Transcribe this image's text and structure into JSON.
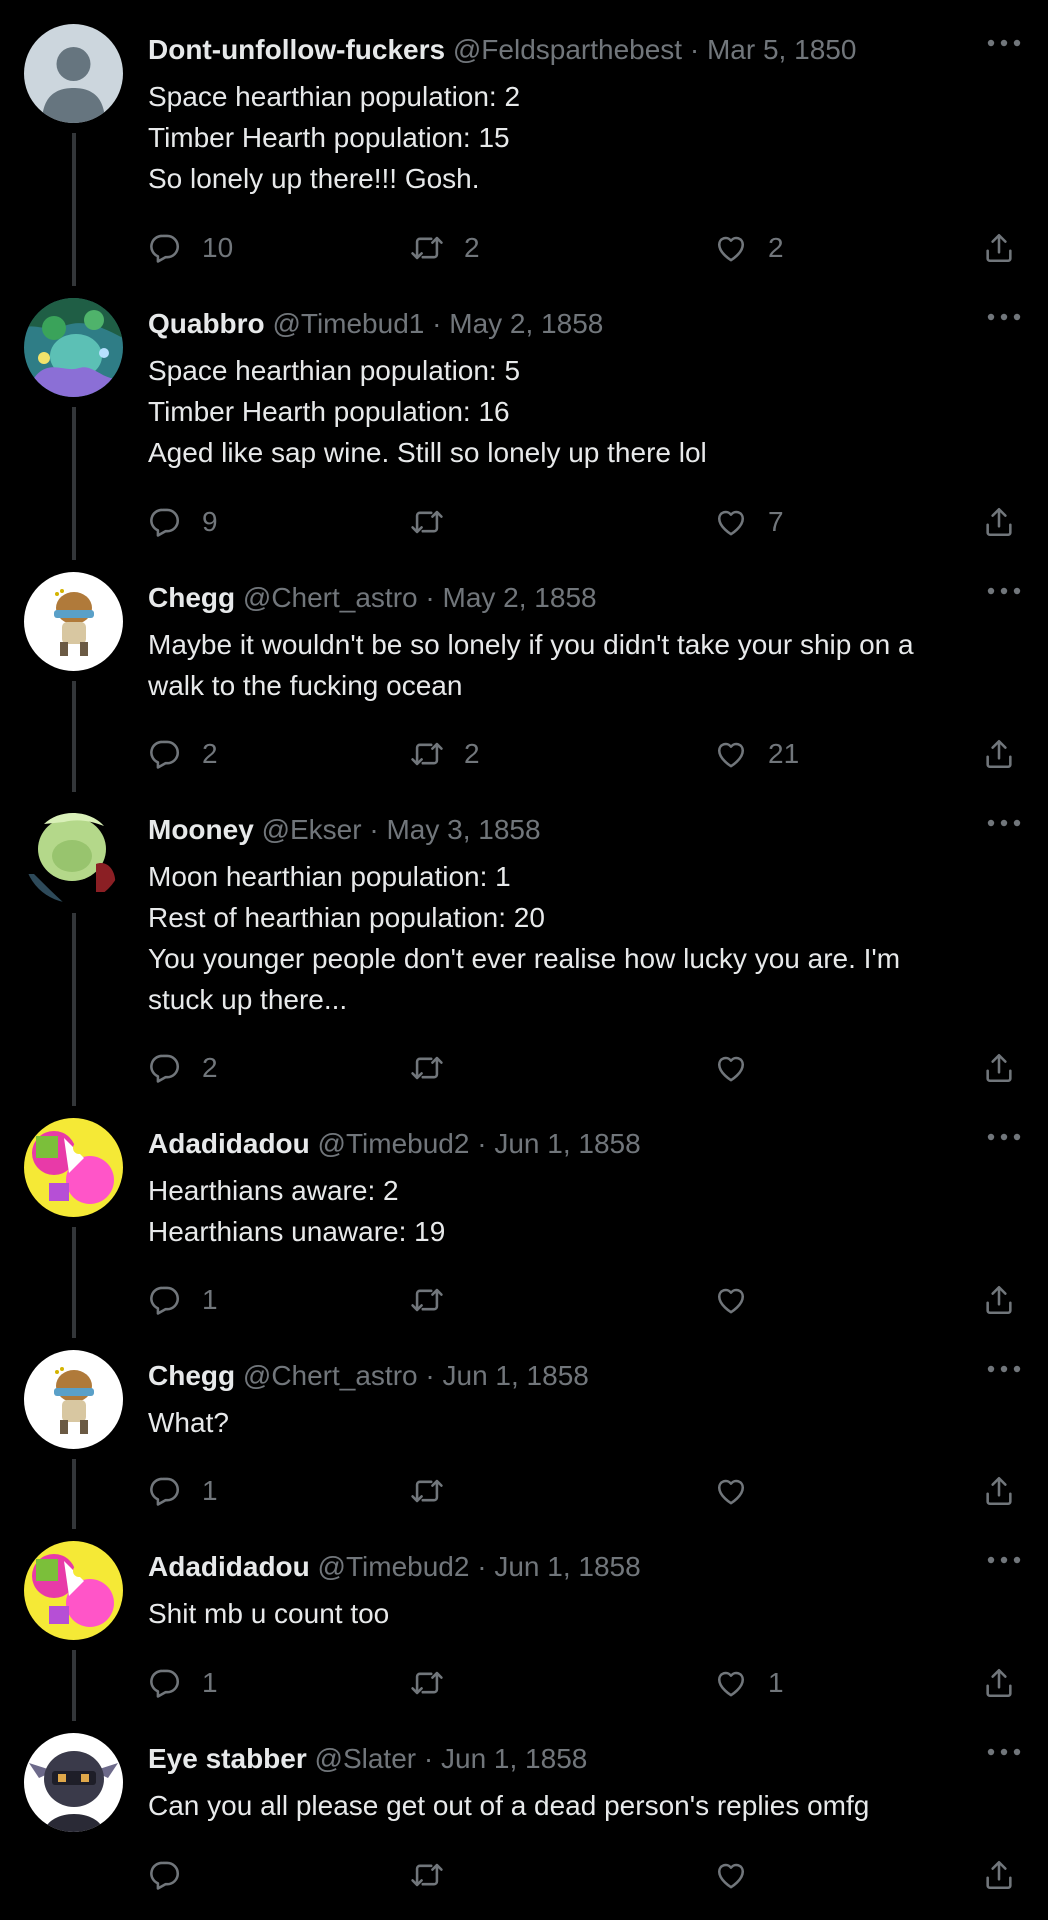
{
  "colors": {
    "background": "#000000",
    "text_primary": "#e7e9ea",
    "text_secondary": "#71767b",
    "thread_line": "#333639"
  },
  "icons": {
    "more": "more-horizontal-icon",
    "reply": "reply-bubble-icon",
    "retweet": "retweet-icon",
    "like": "heart-icon",
    "share": "share-upload-icon"
  },
  "tweets": [
    {
      "name": "Dont-unfollow-fuckers",
      "handle": "@Feldsparthebest",
      "separator": "·",
      "date": "Mar 5, 1850",
      "lines": [
        "Space hearthian population: 2",
        "Timber Hearth population: 15",
        "So lonely up there!!! Gosh."
      ],
      "replies": "10",
      "retweets": "2",
      "likes": "2"
    },
    {
      "name": "Quabbro",
      "handle": "@Timebud1",
      "separator": "·",
      "date": "May 2, 1858",
      "lines": [
        "Space hearthian population: 5",
        "Timber Hearth population: 16",
        "Aged like sap wine. Still so lonely up there lol"
      ],
      "replies": "9",
      "retweets": "",
      "likes": "7"
    },
    {
      "name": "Chegg",
      "handle": "@Chert_astro",
      "separator": "·",
      "date": "May 2, 1858",
      "lines": [
        "Maybe it wouldn't be so lonely if you didn't take your ship on a",
        "walk to the fucking ocean"
      ],
      "replies": "2",
      "retweets": "2",
      "likes": "21"
    },
    {
      "name": "Mooney",
      "handle": "@Ekser",
      "separator": "·",
      "date": "May 3, 1858",
      "lines": [
        "Moon hearthian population: 1",
        "Rest of hearthian population: 20",
        "You younger people don't ever realise how lucky you are. I'm",
        "stuck up there..."
      ],
      "replies": "2",
      "retweets": "",
      "likes": ""
    },
    {
      "name": "Adadidadou",
      "handle": "@Timebud2",
      "separator": "·",
      "date": "Jun 1, 1858",
      "lines": [
        "Hearthians aware: 2",
        "Hearthians unaware: 19"
      ],
      "replies": "1",
      "retweets": "",
      "likes": ""
    },
    {
      "name": "Chegg",
      "handle": "@Chert_astro",
      "separator": "·",
      "date": "Jun 1, 1858",
      "lines": [
        "What?"
      ],
      "replies": "1",
      "retweets": "",
      "likes": ""
    },
    {
      "name": "Adadidadou",
      "handle": "@Timebud2",
      "separator": "·",
      "date": "Jun 1, 1858",
      "lines": [
        "Shit mb u count too"
      ],
      "replies": "1",
      "retweets": "",
      "likes": "1"
    },
    {
      "name": "Eye stabber",
      "handle": "@Slater",
      "separator": "·",
      "date": "Jun 1, 1858",
      "lines": [
        "Can you all please get out of a dead person's replies omfg"
      ],
      "replies": "",
      "retweets": "",
      "likes": ""
    }
  ]
}
